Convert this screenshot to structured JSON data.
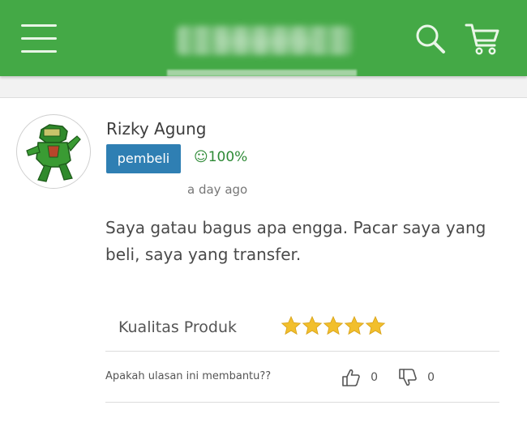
{
  "colors": {
    "header": "#44a946",
    "badge": "#2f7fb3",
    "star": "#f2bf2c",
    "rating_text": "#2e8a36"
  },
  "header": {
    "menu_icon": "hamburger-icon",
    "brand": "tokopedia",
    "search_icon": "search-icon",
    "cart_icon": "cart-icon"
  },
  "review": {
    "reviewer_name": "Rizky Agung",
    "badge_label": "pembeli",
    "reputation": "☺100%",
    "time_ago": "a day ago",
    "text": "Saya gatau bagus apa engga. Pacar saya yang beli, saya yang transfer.",
    "quality_label": "Kualitas Produk",
    "stars": 5,
    "helpful_question": "Apakah ulasan ini membantu??",
    "thumbs_up_count": "0",
    "thumbs_down_count": "0"
  }
}
